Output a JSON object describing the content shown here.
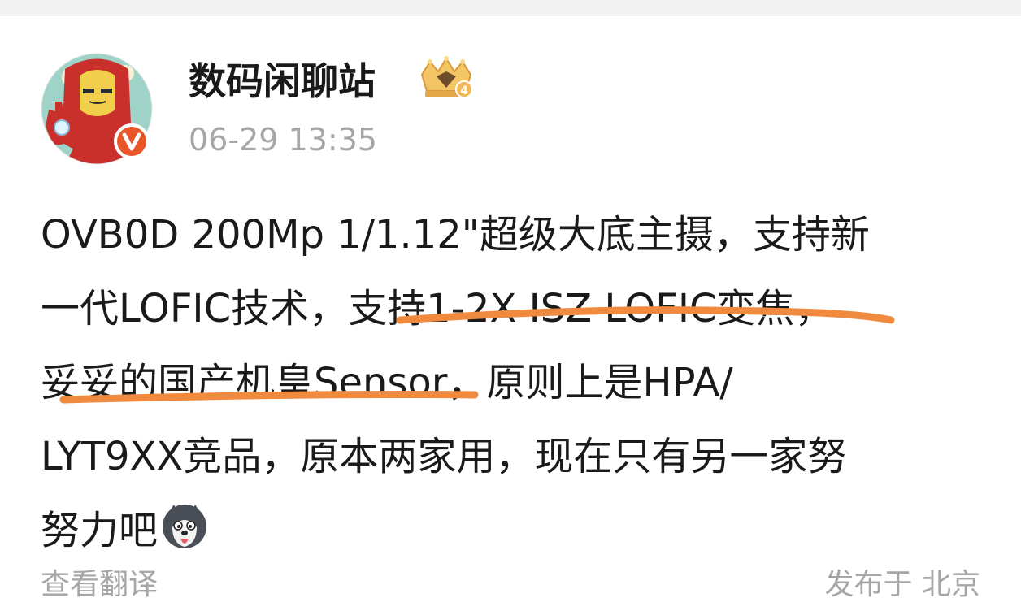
{
  "post": {
    "author": "数码闲聊站",
    "timestamp": "06-29 13:35",
    "content_lines": [
      "OVB0D 200Mp 1/1.12\"超级大底主摄，支持新",
      "一代LOFIC技术，支持1-2X ISZ LOFIC变焦，",
      "妥妥的国产机皇Sensor，原则上是HPA/",
      "LYT9XX竞品，原本两家用，现在只有另一家努",
      "努力吧"
    ],
    "translate_label": "查看翻译",
    "location_label": "发布于 北京"
  },
  "icons": {
    "avatar": "iron-man-avatar-icon",
    "verified_badge": "verified-v-badge-icon",
    "crown": "crown-level-4-icon",
    "emoji": "husky-emoji-icon"
  },
  "colors": {
    "underline": "#ef8a3f",
    "verified": "#e8562a",
    "meta_text": "#a6a6a6",
    "body_text": "#1a1a1a"
  }
}
